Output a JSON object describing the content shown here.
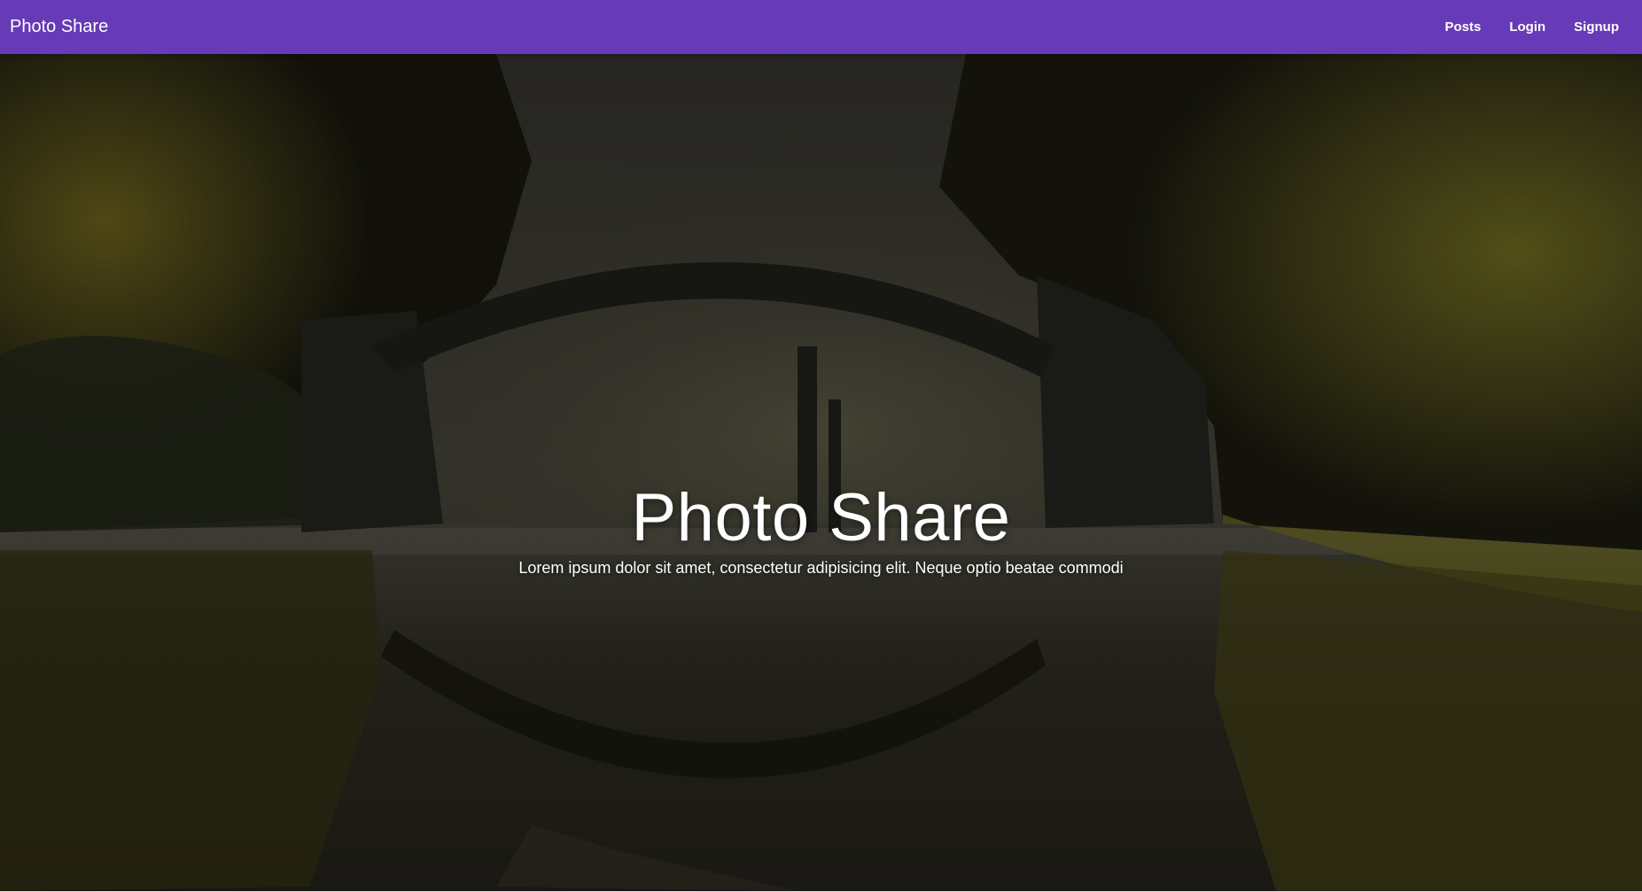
{
  "brand": "Photo Share",
  "nav": {
    "posts": "Posts",
    "login": "Login",
    "signup": "Signup"
  },
  "hero": {
    "title": "Photo Share",
    "subtitle": "Lorem ipsum dolor sit amet, consectetur adipisicing elit. Neque optio beatae commodi",
    "image": "forest-arch-bridge-reflection"
  },
  "colors": {
    "app_bar": "#673ab7",
    "text": "#ffffff"
  }
}
